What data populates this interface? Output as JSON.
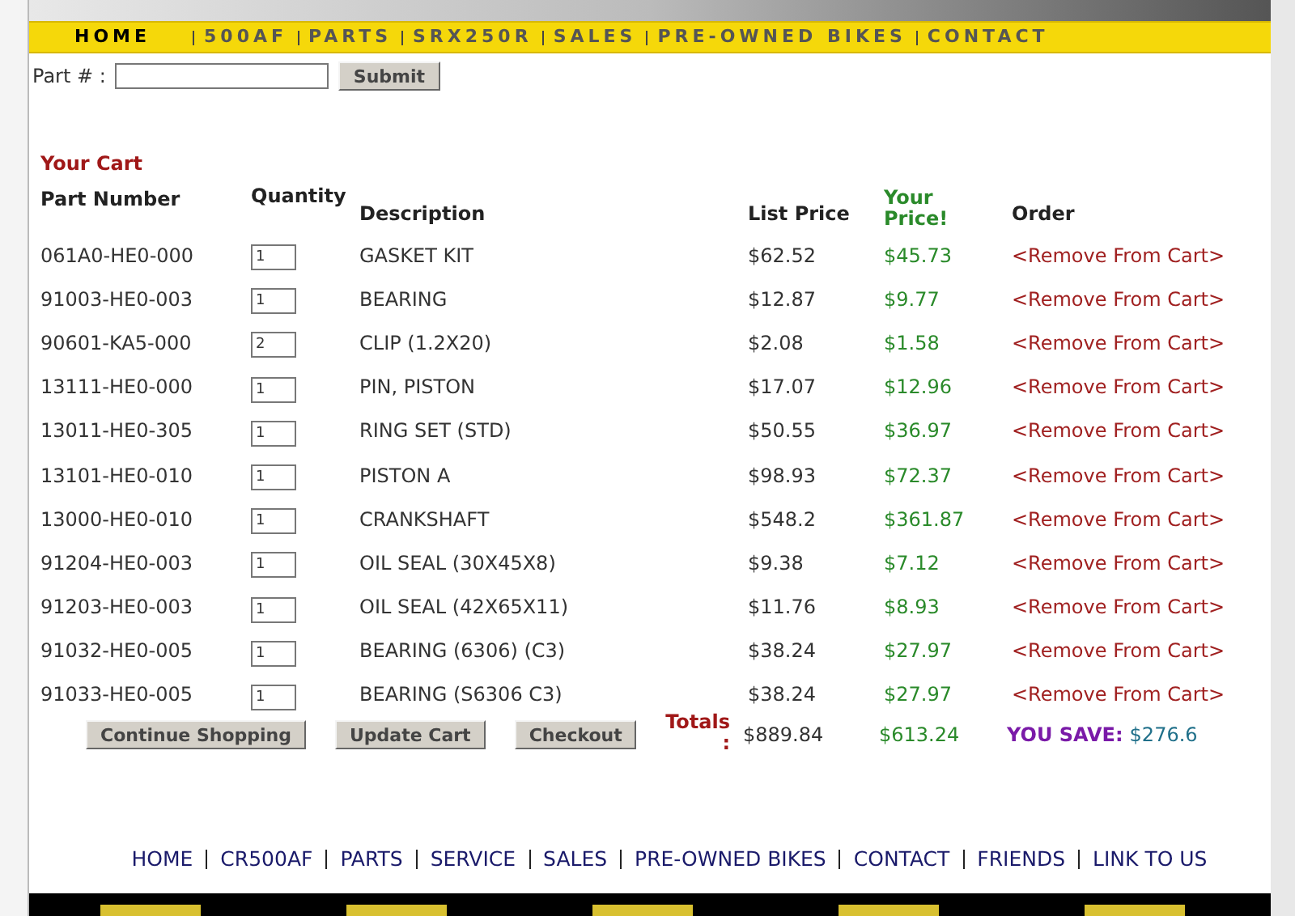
{
  "nav": [
    {
      "label": "HOME",
      "selected": true
    },
    {
      "label": "500AF",
      "selected": false
    },
    {
      "label": "PARTS",
      "selected": false
    },
    {
      "label": "SRX250R",
      "selected": false
    },
    {
      "label": "SALES",
      "selected": false
    },
    {
      "label": "PRE-OWNED BIKES",
      "selected": false
    },
    {
      "label": "CONTACT",
      "selected": false
    }
  ],
  "part_search": {
    "label": "Part # :",
    "button": "Submit"
  },
  "cart": {
    "title": "Your Cart",
    "columns": [
      "Part Number",
      "Quantity",
      "Description",
      "List Price",
      "Your Price!",
      "Order"
    ],
    "rows": [
      {
        "part_number": "061A0-HE0-000",
        "quantity": "1",
        "description": "GASKET KIT",
        "list_price": "$62.52",
        "your_price": "$45.73",
        "order": "<Remove From Cart>"
      },
      {
        "part_number": "91003-HE0-003",
        "quantity": "1",
        "description": "BEARING",
        "list_price": "$12.87",
        "your_price": "$9.77",
        "order": "<Remove From Cart>"
      },
      {
        "part_number": "90601-KA5-000",
        "quantity": "2",
        "description": "CLIP (1.2X20)",
        "list_price": "$2.08",
        "your_price": "$1.58",
        "order": "<Remove From Cart>"
      },
      {
        "part_number": "13111-HE0-000",
        "quantity": "1",
        "description": "PIN, PISTON",
        "list_price": "$17.07",
        "your_price": "$12.96",
        "order": "<Remove From Cart>"
      },
      {
        "part_number": "13011-HE0-305",
        "quantity": "1",
        "description": "RING SET (STD)",
        "list_price": "$50.55",
        "your_price": "$36.97",
        "order": "<Remove From Cart>"
      },
      {
        "part_number": "13101-HE0-010",
        "quantity": "1",
        "description": "PISTON A",
        "list_price": "$98.93",
        "your_price": "$72.37",
        "order": "<Remove From Cart>"
      },
      {
        "part_number": "13000-HE0-010",
        "quantity": "1",
        "description": "CRANKSHAFT",
        "list_price": "$548.2",
        "your_price": "$361.87",
        "order": "<Remove From Cart>"
      },
      {
        "part_number": "91204-HE0-003",
        "quantity": "1",
        "description": "OIL SEAL (30X45X8)",
        "list_price": "$9.38",
        "your_price": "$7.12",
        "order": "<Remove From Cart>"
      },
      {
        "part_number": "91203-HE0-003",
        "quantity": "1",
        "description": "OIL SEAL (42X65X11)",
        "list_price": "$11.76",
        "your_price": "$8.93",
        "order": "<Remove From Cart>"
      },
      {
        "part_number": "91032-HE0-005",
        "quantity": "1",
        "description": "BEARING (6306) (C3)",
        "list_price": "$38.24",
        "your_price": "$27.97",
        "order": "<Remove From Cart>"
      },
      {
        "part_number": "91033-HE0-005",
        "quantity": "1",
        "description": "BEARING (S6306 C3)",
        "list_price": "$38.24",
        "your_price": "$27.97",
        "order": "<Remove From Cart>"
      }
    ],
    "buttons": [
      "Continue Shopping",
      "Update Cart",
      "Checkout"
    ],
    "totals": {
      "label": "Totals :",
      "list_price": "$889.84",
      "your_price": "$613.24",
      "save_label": "YOU SAVE:",
      "save_value": "$276.6"
    }
  },
  "footer_links": [
    "HOME",
    "CR500AF",
    "PARTS",
    "SERVICE",
    "SALES",
    "PRE-OWNED BIKES",
    "CONTACT",
    "FRIENDS",
    "LINK TO US"
  ]
}
